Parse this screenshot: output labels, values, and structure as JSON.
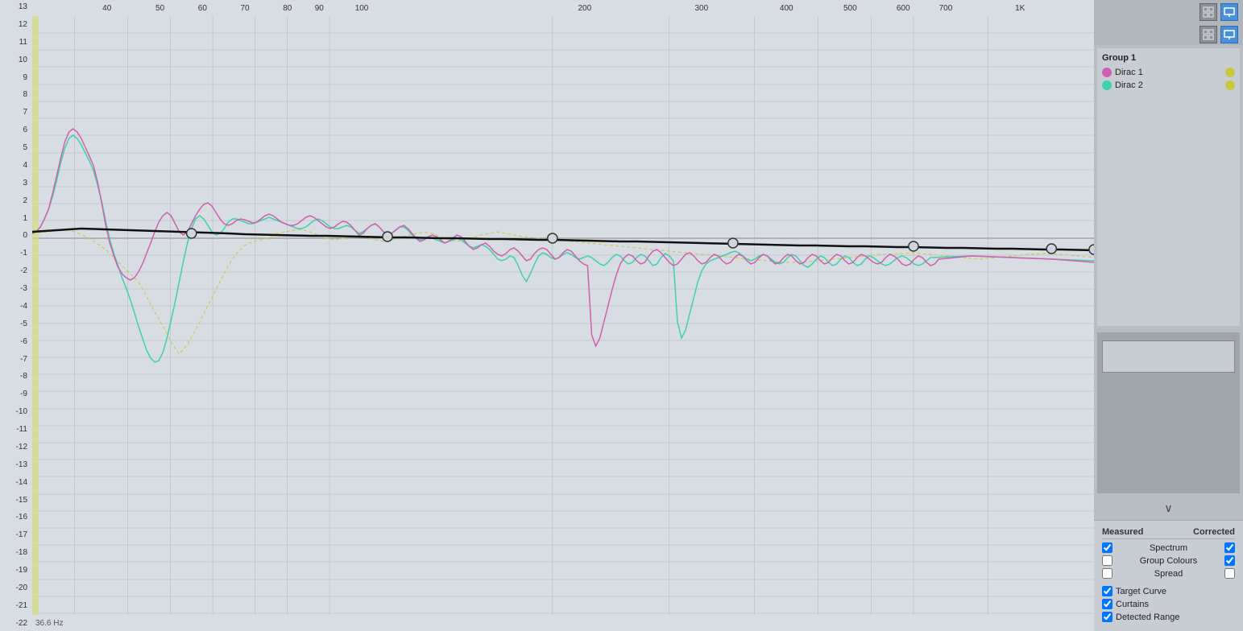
{
  "sidebar": {
    "group_title": "Group 1",
    "channels": [
      {
        "label": "Dirac 1",
        "dot_color": "#d060b0",
        "end_color": "#c8c840"
      },
      {
        "label": "Dirac 2",
        "dot_color": "#40d0b0",
        "end_color": "#c8c840"
      }
    ],
    "collapse_icon": "∨"
  },
  "bottom_panel": {
    "col_measured": "Measured",
    "col_corrected": "Corrected",
    "rows": [
      {
        "label": "Spectrum",
        "measured": true,
        "corrected": true
      },
      {
        "label": "Group Colours",
        "measured": false,
        "corrected": true
      },
      {
        "label": "Spread",
        "measured": false,
        "corrected": false
      }
    ],
    "extra_rows": [
      {
        "label": "Target Curve",
        "checked": true
      },
      {
        "label": "Curtains",
        "checked": true
      },
      {
        "label": "Detected Range",
        "checked": true
      }
    ]
  },
  "chart": {
    "freq_label": "36.6 Hz",
    "y_labels": [
      "13",
      "12",
      "11",
      "10",
      "9",
      "8",
      "7",
      "6",
      "5",
      "4",
      "3",
      "2",
      "1",
      "0",
      "-1",
      "-2",
      "-3",
      "-4",
      "-5",
      "-6",
      "-7",
      "-8",
      "-9",
      "-10",
      "-11",
      "-12",
      "-13",
      "-14",
      "-15",
      "-16",
      "-17",
      "-18",
      "-19",
      "-20",
      "-21",
      "-22"
    ],
    "x_labels": [
      {
        "val": "40",
        "pct": 4
      },
      {
        "val": "50",
        "pct": 9
      },
      {
        "val": "60",
        "pct": 13
      },
      {
        "val": "70",
        "pct": 17
      },
      {
        "val": "80",
        "pct": 21
      },
      {
        "val": "90",
        "pct": 24
      },
      {
        "val": "100",
        "pct": 28
      },
      {
        "val": "200",
        "pct": 49
      },
      {
        "val": "300",
        "pct": 60
      },
      {
        "val": "400",
        "pct": 68
      },
      {
        "val": "500",
        "pct": 74
      },
      {
        "val": "600",
        "pct": 79
      },
      {
        "val": "700",
        "pct": 83
      },
      {
        "val": "1K",
        "pct": 90
      }
    ]
  },
  "icons": {
    "top_right_1": "⊞",
    "top_right_2": "⊟",
    "second_1": "⊞",
    "second_2": "⊟"
  }
}
